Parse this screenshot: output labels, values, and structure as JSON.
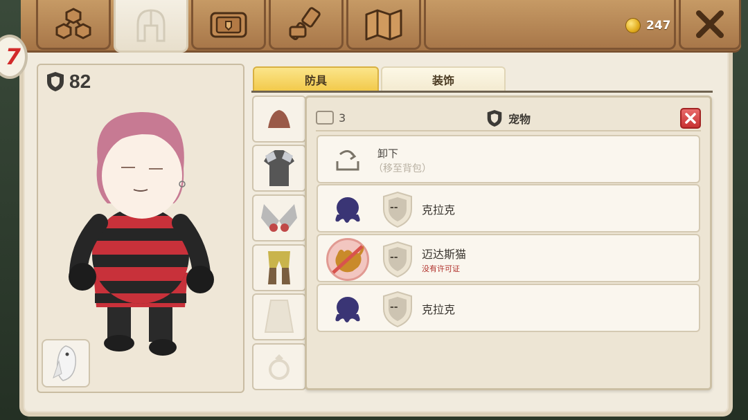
{
  "currency": {
    "amount": "247"
  },
  "level": {
    "value": "7"
  },
  "stats": {
    "armor": "82"
  },
  "tabs": [
    {
      "name": "skills",
      "icon": "hexagon-cluster-icon"
    },
    {
      "name": "equipment",
      "icon": "helmet-icon"
    },
    {
      "name": "inventory",
      "icon": "chest-icon"
    },
    {
      "name": "crafting",
      "icon": "hammer-icon"
    },
    {
      "name": "map",
      "icon": "map-icon"
    }
  ],
  "subtabs": {
    "armor": "防具",
    "decoration": "装饰"
  },
  "pet_panel": {
    "count": "3",
    "title": "宠物",
    "unequip": {
      "label": "卸下",
      "hint": "（移至背包）"
    },
    "pets": [
      {
        "name": "克拉克",
        "shield": "--",
        "warning": ""
      },
      {
        "name": "迈达斯猫",
        "shield": "--",
        "warning": "没有许可证"
      },
      {
        "name": "克拉克",
        "shield": "--",
        "warning": ""
      }
    ]
  },
  "colors": {
    "accent_gold": "#f2c94a",
    "close_red": "#c83232",
    "warning_red": "#b0302a"
  }
}
